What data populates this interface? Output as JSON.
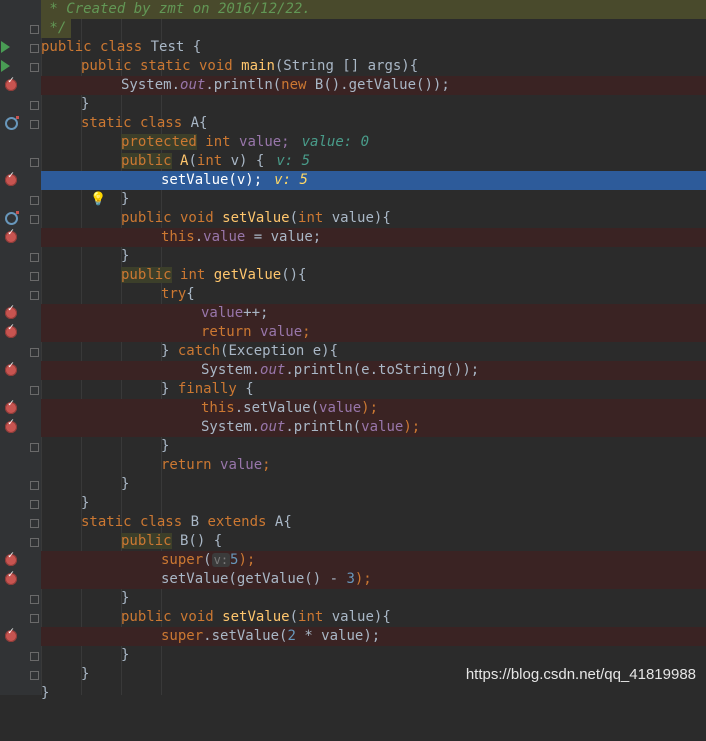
{
  "header": {
    "created": " * Created by zmt on 2016/12/22.",
    "close": " */"
  },
  "code": {
    "l1_public": "public",
    "l1_class": "class",
    "l1_name": "Test {",
    "l2_kw": "public static void",
    "l2_fn": "main",
    "l2_rest": "(String [] args){",
    "l3_a": "System.",
    "l3_out": "out",
    "l3_b": ".println(",
    "l3_new": "new",
    "l3_c": " B().getValue());",
    "close_brace": "}",
    "l5_kw": "static class",
    "l5_rest": " A{",
    "l6_kw1": "protected",
    "l6_kw2": "int",
    "l6_fld": "value;",
    "l6_dbg": "value: 0",
    "l7_kw1": "public",
    "l7_fn": "A",
    "l7_a": "(",
    "l7_kw2": "int",
    "l7_b": " v) {",
    "l7_dbg": "v: 5",
    "l8_code": "setValue(v);",
    "l8_dbg": "v: 5",
    "l10_kw": "public void",
    "l10_fn": "setValue",
    "l10_a": "(",
    "l10_kw2": "int",
    "l10_b": " value){",
    "l11_kw": "this",
    "l11_a": ".",
    "l11_fld": "value",
    "l11_b": " = value;",
    "l13_kw": "public",
    "l13_kw2": "int",
    "l13_fn": "getValue",
    "l13_b": "(){",
    "l14_kw": "try",
    "l14_b": "{",
    "l15_fld": "value",
    "l15_b": "++;",
    "l16_kw": "return",
    "l16_fld": "value",
    "l16_b": ";",
    "l17_a": "} ",
    "l17_kw": "catch",
    "l17_b": "(Exception e){",
    "l18_a": "System.",
    "l18_out": "out",
    "l18_b": ".println(e.toString());",
    "l19_a": "} ",
    "l19_kw": "finally",
    "l19_b": " {",
    "l20_kw": "this",
    "l20_a": ".setValue(",
    "l20_fld": "value",
    "l20_b": ");",
    "l21_a": "System.",
    "l21_out": "out",
    "l21_b": ".println(",
    "l21_fld": "value",
    "l21_c": ");",
    "l23_kw": "return",
    "l23_fld": "value",
    "l23_b": ";",
    "l26_kw": "static class",
    "l26_a": " B ",
    "l26_kw2": "extends",
    "l26_b": " A{",
    "l27_kw": "public",
    "l27_a": " B() {",
    "l28_kw": "super",
    "l28_a": "(",
    "l28_hint": "v:",
    "l28_num": "5",
    "l28_b": ");",
    "l29_a": "setValue(getValue() - ",
    "l29_num": "3",
    "l29_b": ");",
    "l31_kw": "public void",
    "l31_fn": "setValue",
    "l31_a": "(",
    "l31_kw2": "int",
    "l31_b": " value){",
    "l32_kw": "super",
    "l32_a": ".setValue(",
    "l32_num": "2",
    "l32_b": " * value);"
  },
  "watermark": "https://blog.csdn.net/qq_41819988",
  "colors": {
    "background": "#2b2b2b",
    "breakpoint_line": "#3a2323",
    "selected_line": "#2d5b9a",
    "keyword": "#cc7832",
    "method": "#ffc66d",
    "field": "#9876aa",
    "comment": "#629755"
  },
  "icons": [
    "run-icon",
    "breakpoint-icon",
    "override-icon",
    "fold-marker-icon",
    "lightbulb-icon"
  ]
}
